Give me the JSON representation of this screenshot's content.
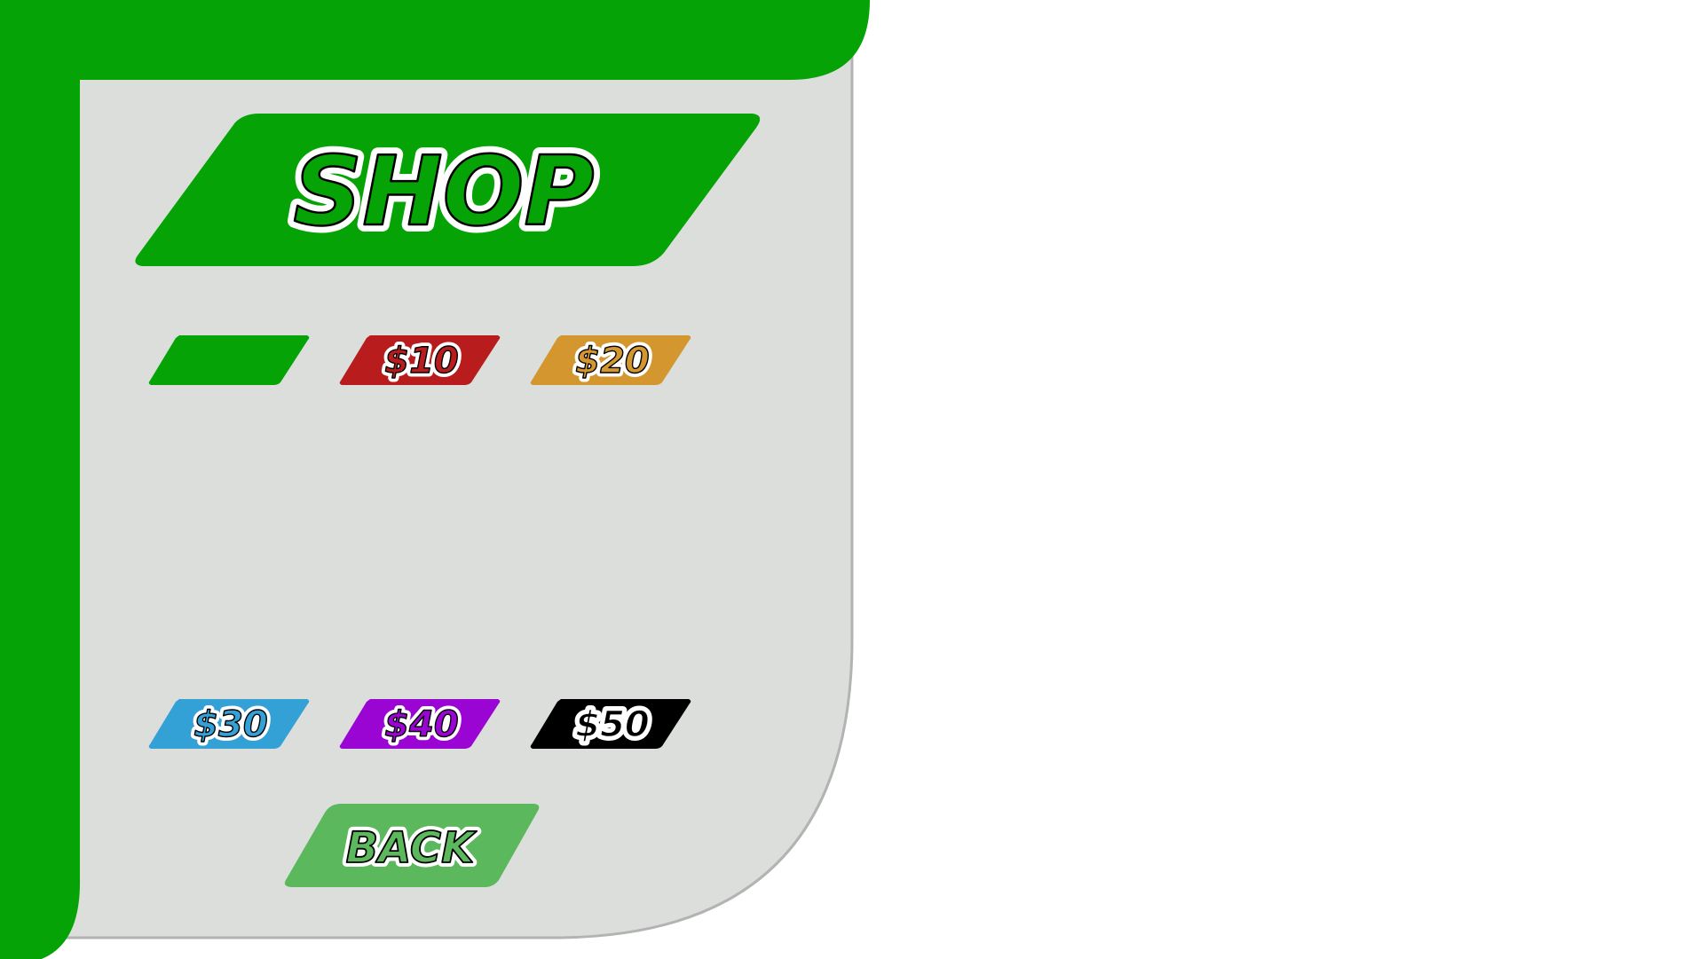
{
  "shop": {
    "title": "SHOP",
    "back_label": "BACK"
  },
  "price_buttons": [
    {
      "label": "",
      "color": "#05a305"
    },
    {
      "label": "$10",
      "color": "#b91c1c"
    },
    {
      "label": "$20",
      "color": "#d4962f"
    },
    {
      "label": "$30",
      "color": "#33a0d6"
    },
    {
      "label": "$40",
      "color": "#9b05d4"
    },
    {
      "label": "$50",
      "color": "#000000"
    }
  ],
  "colors": {
    "frame_green": "#05a305",
    "panel_gray": "#dcdedc",
    "panel_border": "#b3b3b3",
    "title_banner": "#05a305",
    "back_button": "#5cb85c",
    "text_fill": "#ffffff"
  }
}
